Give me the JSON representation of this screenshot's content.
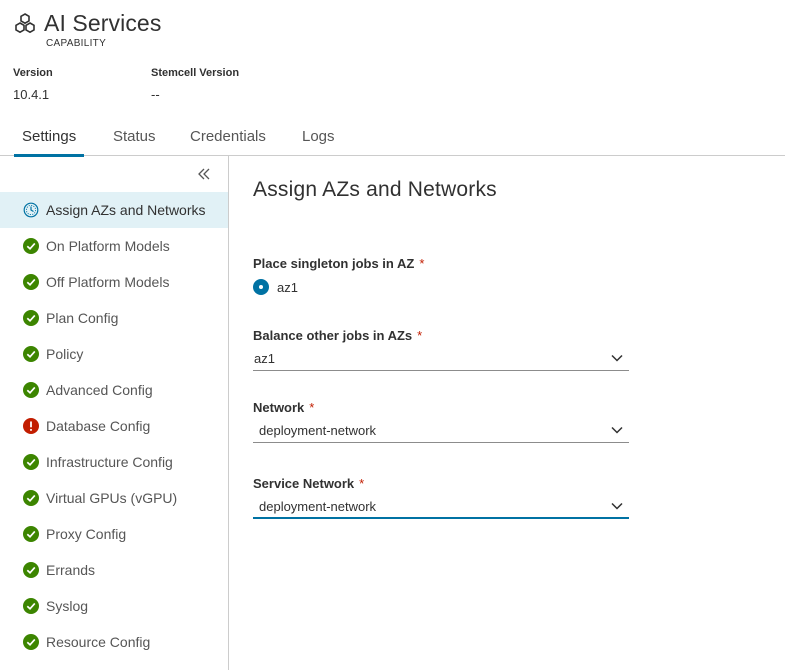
{
  "app": {
    "title": "AI Services",
    "subtitle": "CAPABILITY",
    "icon": "hexagon-cluster-icon"
  },
  "meta": {
    "version_label": "Version",
    "version_value": "10.4.1",
    "stemcell_label": "Stemcell Version",
    "stemcell_value": "--"
  },
  "tabs": [
    {
      "label": "Settings",
      "active": true
    },
    {
      "label": "Status"
    },
    {
      "label": "Credentials"
    },
    {
      "label": "Logs"
    }
  ],
  "sidebar": {
    "collapse_icon": "double-chevron-left-icon",
    "items": [
      {
        "label": "Assign AZs and Networks",
        "status": "in-progress",
        "icon": "clock-icon",
        "active": true
      },
      {
        "label": "On Platform Models",
        "status": "complete",
        "icon": "check-circle-icon"
      },
      {
        "label": "Off Platform Models",
        "status": "complete",
        "icon": "check-circle-icon"
      },
      {
        "label": "Plan Config",
        "status": "complete",
        "icon": "check-circle-icon"
      },
      {
        "label": "Policy",
        "status": "complete",
        "icon": "check-circle-icon"
      },
      {
        "label": "Advanced Config",
        "status": "complete",
        "icon": "check-circle-icon"
      },
      {
        "label": "Database Config",
        "status": "error",
        "icon": "error-circle-icon"
      },
      {
        "label": "Infrastructure Config",
        "status": "complete",
        "icon": "check-circle-icon"
      },
      {
        "label": "Virtual GPUs (vGPU)",
        "status": "complete",
        "icon": "check-circle-icon"
      },
      {
        "label": "Proxy Config",
        "status": "complete",
        "icon": "check-circle-icon"
      },
      {
        "label": "Errands",
        "status": "complete",
        "icon": "check-circle-icon"
      },
      {
        "label": "Syslog",
        "status": "complete",
        "icon": "check-circle-icon"
      },
      {
        "label": "Resource Config",
        "status": "complete",
        "icon": "check-circle-icon"
      }
    ]
  },
  "main": {
    "title": "Assign AZs and Networks",
    "singleton": {
      "label": "Place singleton jobs in AZ",
      "required": "*",
      "option": "az1"
    },
    "balance": {
      "label": "Balance other jobs in AZs",
      "required": "*",
      "value": "az1"
    },
    "network": {
      "label": "Network",
      "required": "*",
      "value": "deployment-network"
    },
    "service_network": {
      "label": "Service Network",
      "required": "*",
      "value": "deployment-network"
    }
  },
  "colors": {
    "accent": "#0072a3",
    "success": "#3c8500",
    "error": "#c21d00",
    "active_bg": "#e1f1f6"
  }
}
